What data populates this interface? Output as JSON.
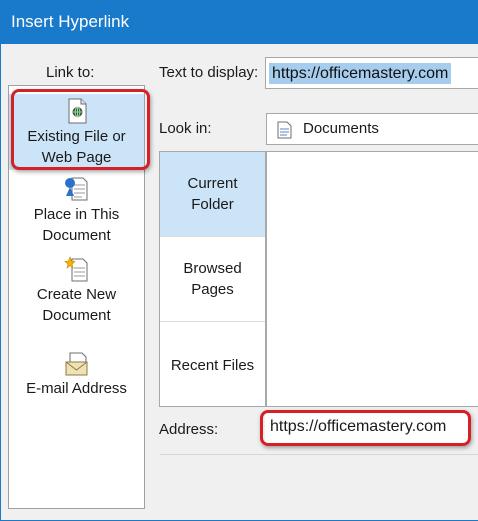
{
  "window": {
    "title": "Insert Hyperlink"
  },
  "link_to": {
    "label": "Link to:",
    "items": [
      {
        "line1": "Existing File or",
        "line2": "Web Page",
        "icon": "existing-file-icon",
        "selected": true
      },
      {
        "line1": "Place in This",
        "line2": "Document",
        "icon": "place-in-document-icon",
        "selected": false
      },
      {
        "line1": "Create New",
        "line2": "Document",
        "icon": "new-document-icon",
        "selected": false
      },
      {
        "line1": "E-mail Address",
        "line2": "",
        "icon": "email-icon",
        "selected": false
      }
    ]
  },
  "text_to_display": {
    "label": "Text to display:",
    "value": "https://officemastery.com"
  },
  "look_in": {
    "label": "Look in:",
    "value": "Documents",
    "icon": "folder-icon"
  },
  "sidebar": {
    "items": [
      {
        "line1": "Current",
        "line2": "Folder",
        "active": true
      },
      {
        "line1": "Browsed",
        "line2": "Pages",
        "active": false
      },
      {
        "line1": "Recent Files",
        "line2": "",
        "active": false
      }
    ]
  },
  "address": {
    "label": "Address:",
    "value": "https://officemastery.com"
  },
  "colors": {
    "title_bar": "#1979ca",
    "selection": "#cce4f7",
    "highlight": "#d42027"
  }
}
